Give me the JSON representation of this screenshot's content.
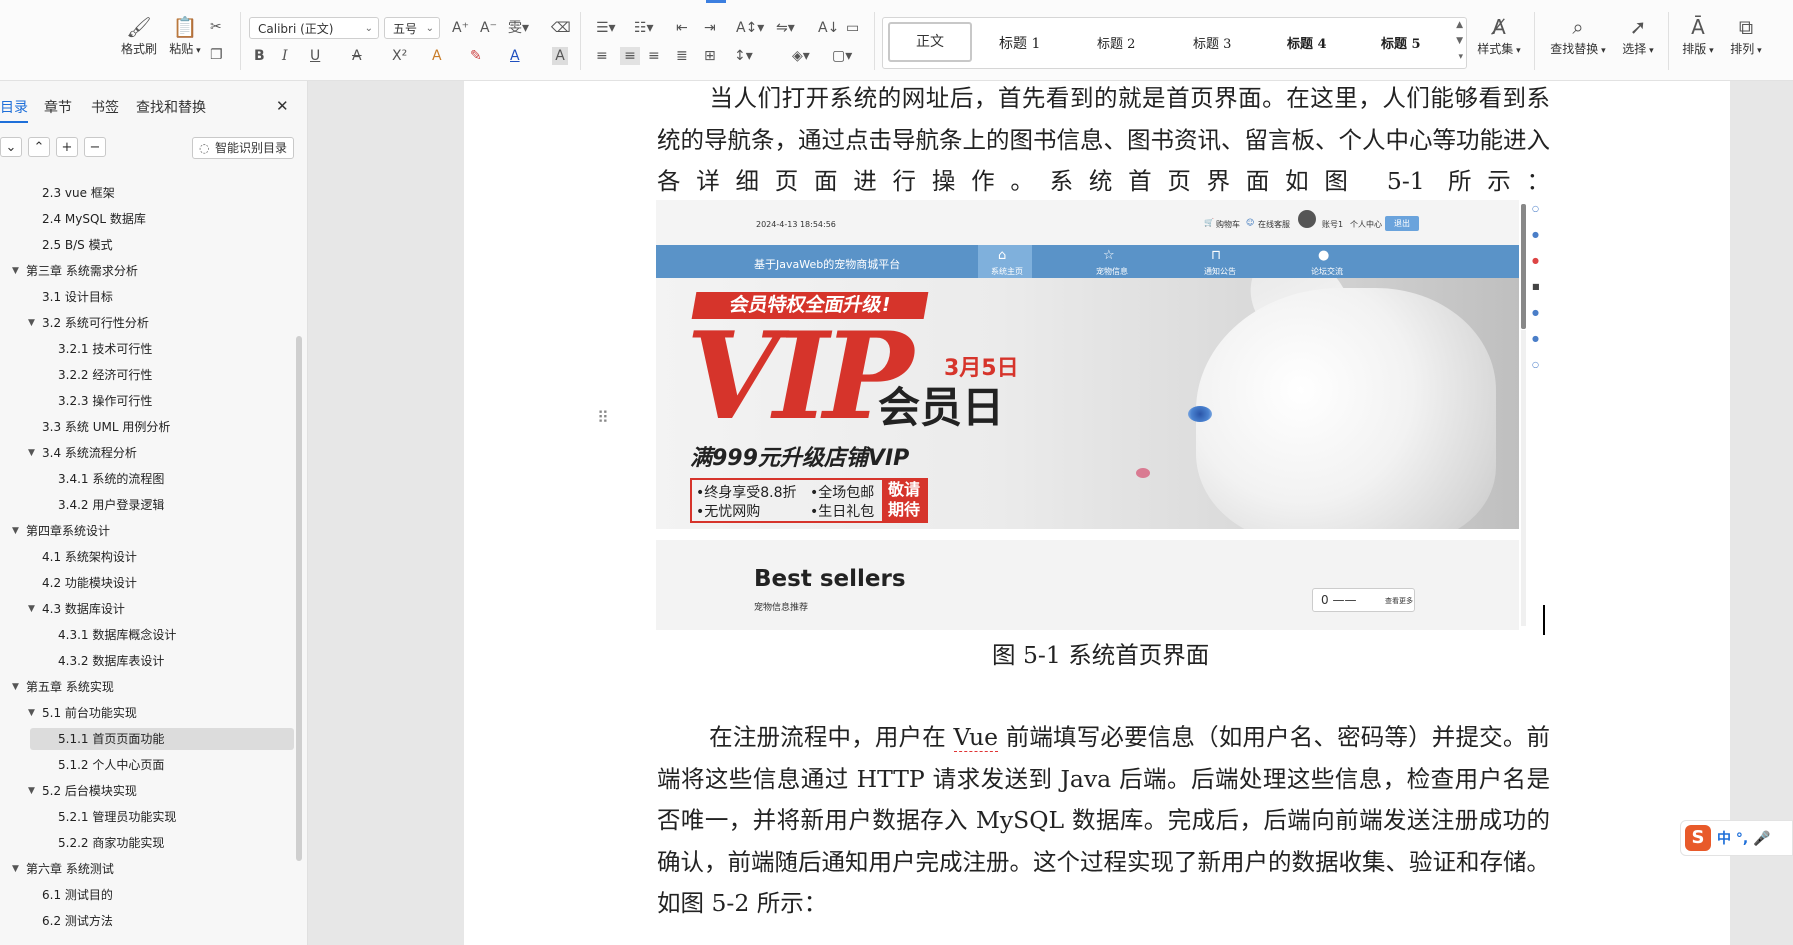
{
  "ribbon": {
    "format_painter": "格式刷",
    "paste": "粘贴",
    "font_name": "Calibri (正文)",
    "font_size": "五号",
    "bold": "B",
    "italic": "I",
    "underline": "U",
    "styles": {
      "normal": "正文",
      "h1": "标题 1",
      "h2": "标题 2",
      "h3": "标题 3",
      "h4": "标题 4",
      "h5": "标题 5"
    },
    "style_set": "样式集",
    "find_replace": "查找替换",
    "select": "选择",
    "layout": "排版",
    "arrange": "排列"
  },
  "nav": {
    "tabs": [
      "目录",
      "章节",
      "书签",
      "查找和替换"
    ],
    "close": "✕",
    "smart_toc": "智能识别目录",
    "items": [
      {
        "label": "2.3 vue 框架",
        "level": 2,
        "arrow": ""
      },
      {
        "label": "2.4 MySQL 数据库",
        "level": 2,
        "arrow": ""
      },
      {
        "label": "2.5 B/S 模式",
        "level": 2,
        "arrow": ""
      },
      {
        "label": "第三章  系统需求分析",
        "level": 1,
        "arrow": "▼"
      },
      {
        "label": "3.1 设计目标",
        "level": 2,
        "arrow": ""
      },
      {
        "label": "3.2 系统可行性分析",
        "level": 2,
        "arrow": "▼"
      },
      {
        "label": "3.2.1 技术可行性",
        "level": 3,
        "arrow": ""
      },
      {
        "label": "3.2.2 经济可行性",
        "level": 3,
        "arrow": ""
      },
      {
        "label": "3.2.3 操作可行性",
        "level": 3,
        "arrow": ""
      },
      {
        "label": "3.3 系统 UML 用例分析",
        "level": 2,
        "arrow": ""
      },
      {
        "label": "3.4 系统流程分析",
        "level": 2,
        "arrow": "▼"
      },
      {
        "label": "3.4.1 系统的流程图",
        "level": 3,
        "arrow": ""
      },
      {
        "label": "3.4.2 用户登录逻辑",
        "level": 3,
        "arrow": ""
      },
      {
        "label": "第四章系统设计",
        "level": 1,
        "arrow": "▼"
      },
      {
        "label": "4.1  系统架构设计",
        "level": 2,
        "arrow": ""
      },
      {
        "label": "4.2 功能模块设计",
        "level": 2,
        "arrow": ""
      },
      {
        "label": "4.3  数据库设计",
        "level": 2,
        "arrow": "▼"
      },
      {
        "label": "4.3.1 数据库概念设计",
        "level": 3,
        "arrow": ""
      },
      {
        "label": "4.3.2  数据库表设计",
        "level": 3,
        "arrow": ""
      },
      {
        "label": "第五章  系统实现",
        "level": 1,
        "arrow": "▼"
      },
      {
        "label": "5.1 前台功能实现",
        "level": 2,
        "arrow": "▼"
      },
      {
        "label": "5.1.1 首页页面功能",
        "level": 3,
        "arrow": "",
        "active": true
      },
      {
        "label": "5.1.2 个人中心页面",
        "level": 3,
        "arrow": ""
      },
      {
        "label": "5.2 后台模块实现",
        "level": 2,
        "arrow": "▼"
      },
      {
        "label": "5.2.1 管理员功能实现",
        "level": 3,
        "arrow": ""
      },
      {
        "label": "5.2.2 商家功能实现",
        "level": 3,
        "arrow": ""
      },
      {
        "label": "第六章  系统测试",
        "level": 1,
        "arrow": "▼"
      },
      {
        "label": "6.1 测试目的",
        "level": 2,
        "arrow": ""
      },
      {
        "label": "6.2 测试方法",
        "level": 2,
        "arrow": ""
      }
    ]
  },
  "doc": {
    "para1": "当人们打开系统的网址后，首先看到的就是首页界面。在这里，人们能够看到系统的导航条，通过点击导航条上的图书信息、图书资讯、留言板、个人中心等功能进入各详细页面进行操作。系统首页界面如图 5-1 所示：",
    "caption": "图 5-1  系统首页界面",
    "para2_a": "在注册流程中，用户在",
    "para2_vue": "Vue",
    "para2_b": "前端填写必要信息（如用户名、密码等）并提交。前端将这些信息通过 HTTP 请求发送到 Java 后端。后端处理这些信息，检查用户名是否唯一，并将新用户数据存入 MySQL 数据库。完成后，后端向前端发送注册成功的确认，前端随后通知用户完成注册。这个过程实现了新用户的数据收集、验证和存储。如图 5-2 所示："
  },
  "figure": {
    "datetime": "2024-4-13 18:54:56",
    "cart": "购物车",
    "service": "在线客服",
    "account": "账号1",
    "personal": "个人中心",
    "logout": "退出",
    "site_title": "基于JavaWeb的宠物商城平台",
    "nav": [
      "系统主页",
      "宠物信息",
      "通知公告",
      "论坛交流"
    ],
    "banner": {
      "headline": "会员特权全面升级!",
      "vip": "VIP",
      "date": "3月5日",
      "day": "会员日",
      "upgrade": "满999元升级店铺VIP",
      "b1": "•终身享受8.8折",
      "b2": "•全场包邮",
      "b3": "•无忧网购",
      "b4": "•生日礼包",
      "wait": "敬请期待"
    },
    "best_title": "Best sellers",
    "best_sub": "宠物信息推荐",
    "more": "查看更多"
  },
  "ime": {
    "logo": "S",
    "text": "中 °, 🎤"
  }
}
